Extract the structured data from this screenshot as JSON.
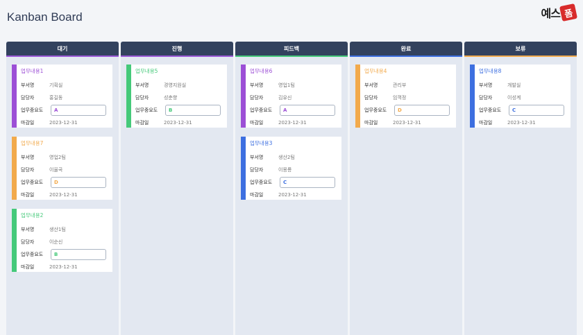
{
  "app": {
    "title": "Kanban Board",
    "logo_text": "예스",
    "logo_mark": "폼"
  },
  "labels": {
    "dept": "부서명",
    "assignee": "담당자",
    "priority": "업무중요도",
    "due": "마감일"
  },
  "colors": {
    "header_bg": "#33425e",
    "purple": "#9c4fd6",
    "orange": "#f2aa4c",
    "green": "#45c97a",
    "blue": "#3d6fe0"
  },
  "columns": [
    {
      "title": "대기",
      "accent": "#9b59d6",
      "cards": [
        {
          "title": "업무내용1",
          "color": "#9c4fd6",
          "dept": "기획실",
          "assignee": "홍길동",
          "priority": "A",
          "due": "2023-12-31"
        },
        {
          "title": "업무내용7",
          "color": "#f2aa4c",
          "dept": "영업2팀",
          "assignee": "이율곡",
          "priority": "D",
          "due": "2023-12-31"
        },
        {
          "title": "업무내용2",
          "color": "#45c97a",
          "dept": "생산1팀",
          "assignee": "이순신",
          "priority": "B",
          "due": "2023-12-31"
        }
      ]
    },
    {
      "title": "진행",
      "accent": "#9b59d6",
      "cards": [
        {
          "title": "업무내용5",
          "color": "#45c97a",
          "dept": "경영지원실",
          "assignee": "성춘향",
          "priority": "B",
          "due": "2023-12-31"
        }
      ]
    },
    {
      "title": "피드백",
      "accent": "#45c97a",
      "cards": [
        {
          "title": "업무내용6",
          "color": "#9c4fd6",
          "dept": "영업1팀",
          "assignee": "김유신",
          "priority": "A",
          "due": "2023-12-31"
        },
        {
          "title": "업무내용3",
          "color": "#3d6fe0",
          "dept": "생산2팀",
          "assignee": "이몽룡",
          "priority": "C",
          "due": "2023-12-31"
        }
      ]
    },
    {
      "title": "완료",
      "accent": "#3d6fe0",
      "cards": [
        {
          "title": "업무내용4",
          "color": "#f2aa4c",
          "dept": "관리부",
          "assignee": "임꺽정",
          "priority": "D",
          "due": "2023-12-31"
        }
      ]
    },
    {
      "title": "보류",
      "accent": "#f2aa4c",
      "cards": [
        {
          "title": "업무내용8",
          "color": "#3d6fe0",
          "dept": "개발실",
          "assignee": "이성계",
          "priority": "C",
          "due": "2023-12-31"
        }
      ]
    }
  ]
}
